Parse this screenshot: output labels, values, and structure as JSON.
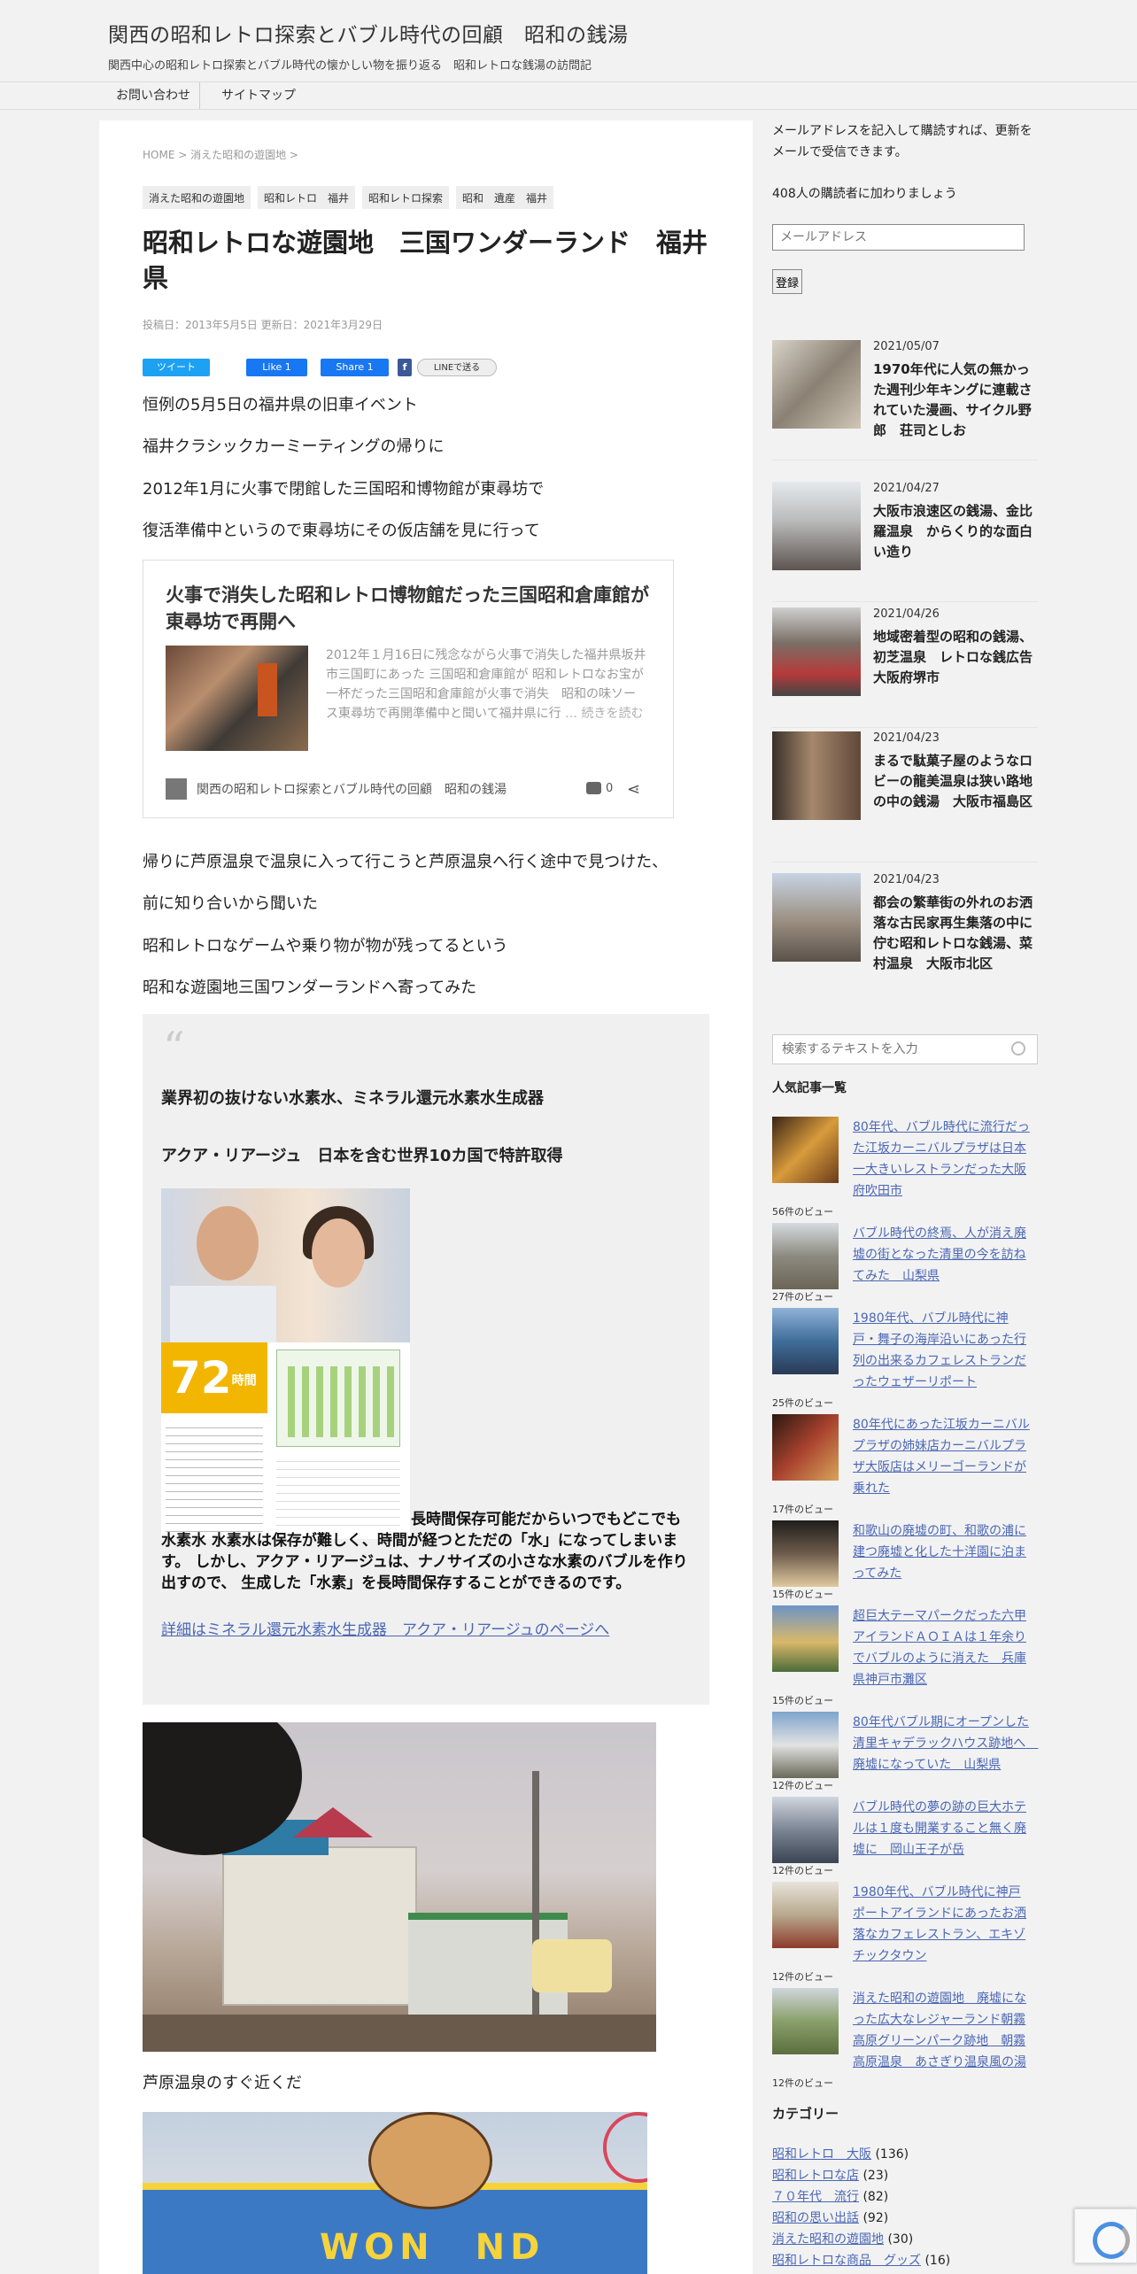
{
  "site": {
    "title": "関西の昭和レトロ探索とバブル時代の回顧　昭和の銭湯",
    "description": "関西中心の昭和レトロ探索とバブル時代の懐かしい物を振り返る　昭和レトロな銭湯の訪問記"
  },
  "nav": [
    "お問い合わせ",
    "サイトマップ"
  ],
  "breadcrumb": "HOME > 消えた昭和の遊園地 >",
  "categories": [
    "消えた昭和の遊園地",
    "昭和レトロ　福井",
    "昭和レトロ探索",
    "昭和　遺産　福井"
  ],
  "post": {
    "title": "昭和レトロな遊園地　三国ワンダーランド　福井県",
    "date": "投稿日：2013年5月5日 更新日：2021年3月29日",
    "paragraphs_top": [
      "恒例の5月5日の福井県の旧車イベント",
      "福井クラシックカーミーティングの帰りに",
      "2012年1月に火事で閉館した三国昭和博物館が東尋坊で",
      "復活準備中というので東尋坊にその仮店舗を見に行って"
    ],
    "paragraphs_mid": [
      "帰りに芦原温泉で温泉に入って行こうと芦原温泉へ行く途中で見つけた、",
      "前に知り合いから聞いた",
      "昭和レトロなゲームや乗り物が物が残ってるという",
      "昭和な遊園地三国ワンダーランドへ寄ってみた"
    ],
    "caption_after_photo": "芦原温泉のすぐ近くだ"
  },
  "share": {
    "tweet": "ツイート",
    "like": "Like 1",
    "share": "Share 1",
    "fb": "f",
    "line": "LINEで送る"
  },
  "blogcard": {
    "title": "火事で消失した昭和レトロ博物館だった三国昭和倉庫館が東尋坊で再開へ",
    "excerpt": "2012年１月16日に残念ながら火事で消失した福井県坂井市三国町にあった 三国昭和倉庫館が 昭和レトロなお宝が一杯だった三国昭和倉庫館が火事で消失　昭和の味ソース東尋坊で再開準備中と聞いて福井県に行",
    "more": "… 続きを読む",
    "site": "関西の昭和レトロ探索とバブル時代の回顧　昭和の銭湯",
    "comments": "0"
  },
  "quote": {
    "mark": "“",
    "heading1": "業界初の抜けない水素水、ミネラル還元水素水生成器",
    "heading2": "アクア・リアージュ　日本を含む世界10カ国で特許取得",
    "image_number": "72",
    "image_unit": "時間",
    "body_lead": "長時間保存可能だからいつでもどこでも水素水",
    "body": "水素水は保存が難しく、時間が経つとただの「水」になってしまいます。 しかし、アクア・リアージュは、ナノサイズの小さな水素のバブルを作り出すので、 生成した「水素」を長時間保存することができるのです。",
    "link": "詳細はミネラル還元水素水生成器　アクア・リアージュのページへ"
  },
  "sidebar": {
    "subscribe_text": "メールアドレスを記入して購読すれば、更新をメールで受信できます。",
    "subscribe_count": "408人の購読者に加わりましょう",
    "email_placeholder": "メールアドレス",
    "submit_label": "登録",
    "recent_posts": [
      {
        "date": "2021/05/07",
        "title": "1970年代に人気の無かった週刊少年キングに連載されていた漫画、サイクル野郎　荘司としお"
      },
      {
        "date": "2021/04/27",
        "title": "大阪市浪速区の銭湯、金比羅温泉　からくり的な面白い造り"
      },
      {
        "date": "2021/04/26",
        "title": "地域密着型の昭和の銭湯、初芝温泉　レトロな銭広告　大阪府堺市"
      },
      {
        "date": "2021/04/23",
        "title": "まるで駄菓子屋のようなロビーの龍美温泉は狭い路地の中の銭湯　大阪市福島区"
      },
      {
        "date": "2021/04/23",
        "title": "都会の繁華街の外れのお洒落な古民家再生集落の中に佇む昭和レトロな銭湯、菜村温泉　大阪市北区"
      }
    ],
    "search_placeholder": "検索するテキストを入力",
    "popular_title": "人気記事一覧",
    "popular": [
      {
        "title": "80年代、バブル時代に流行だった江坂カーニバルプラザは日本一大きいレストランだった大阪府吹田市",
        "views": "56件のビュー"
      },
      {
        "title": "バブル時代の終焉、人が消え廃墟の街となった清里の今を訪ねてみた　山梨県",
        "views": "27件のビュー"
      },
      {
        "title": "1980年代、バブル時代に神戸・舞子の海岸沿いにあった行列の出来るカフェレストランだったウェザーリポート",
        "views": "25件のビュー"
      },
      {
        "title": "80年代にあった江坂カーニバルプラザの姉妹店カーニバルプラザ大阪店はメリーゴーランドが乗れた",
        "views": "17件のビュー"
      },
      {
        "title": "和歌山の廃墟の町、和歌の浦に建つ廃墟と化した十洋園に泊まってみた",
        "views": "15件のビュー"
      },
      {
        "title": "超巨大テーマパークだった六甲アイランドＡＯＩＡは１年余りでバブルのように消えた　兵庫県神戸市灘区",
        "views": "15件のビュー"
      },
      {
        "title": "80年代バブル期にオープンした清里キャデラックハウス跡地へ　廃墟になっていた　山梨県",
        "views": "12件のビュー"
      },
      {
        "title": "バブル時代の夢の跡の巨大ホテルは１度も開業すること無く廃墟に　岡山王子が岳",
        "views": "12件のビュー"
      },
      {
        "title": "1980年代、バブル時代に神戸ポートアイランドにあったお洒落なカフェレストラン、エキゾチックタウン",
        "views": "12件のビュー"
      },
      {
        "title": "消えた昭和の遊園地　廃墟になった広大なレジャーランド朝霧高原グリーンパーク跡地　朝霧高原温泉　あさぎり温泉風の湯",
        "views": "12件のビュー"
      }
    ],
    "categories_title": "カテゴリー",
    "category_links": [
      {
        "name": "昭和レトロ　大阪",
        "count": "(136)"
      },
      {
        "name": "昭和レトロな店",
        "count": "(23)"
      },
      {
        "name": "７０年代　流行",
        "count": "(82)"
      },
      {
        "name": "昭和の思い出話",
        "count": "(92)"
      },
      {
        "name": "消えた昭和の遊園地",
        "count": "(30)"
      },
      {
        "name": "昭和レトロな商品　グッズ",
        "count": "(16)"
      }
    ]
  }
}
